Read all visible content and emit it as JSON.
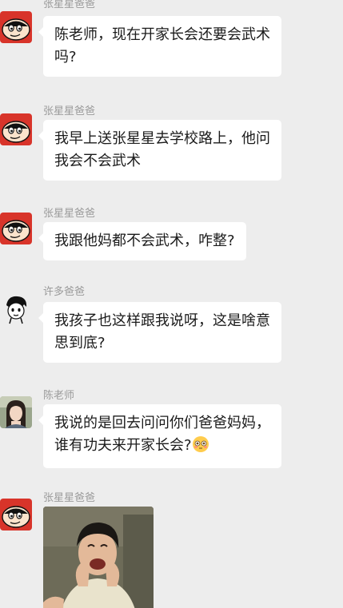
{
  "messages": [
    {
      "sender": "张星星爸爸",
      "avatar_icon": "crayon-shinchan-avatar",
      "lines": [
        "陈老师，现在开家长会还要会武术",
        "吗?"
      ]
    },
    {
      "sender": "张星星爸爸",
      "avatar_icon": "crayon-shinchan-avatar",
      "lines": [
        "我早上送张星星去学校路上，他问",
        "我会不会武术"
      ]
    },
    {
      "sender": "张星星爸爸",
      "avatar_icon": "crayon-shinchan-avatar",
      "lines": [
        "我跟他妈都不会武术，咋整?"
      ]
    },
    {
      "sender": "许多爸爸",
      "avatar_icon": "cartoon-face-avatar",
      "lines": [
        "我孩子也这样跟我说呀，这是啥意",
        "思到底?"
      ]
    },
    {
      "sender": "陈老师",
      "avatar_icon": "photo-portrait-avatar",
      "lines": [
        "我说的是回去问问你们爸爸妈妈，",
        "谁有功夫来开家长会?"
      ],
      "emoji_icon": "flushed-face-emoji-icon"
    },
    {
      "sender": "张星星爸爸",
      "avatar_icon": "crayon-shinchan-avatar",
      "image_icon": "laughing-man-photo"
    }
  ],
  "colors": {
    "background": "#ededed",
    "bubble": "#ffffff",
    "sender_name": "#9a9a9a",
    "text": "#1b1b1b",
    "shinchan_red": "#d8342a"
  }
}
